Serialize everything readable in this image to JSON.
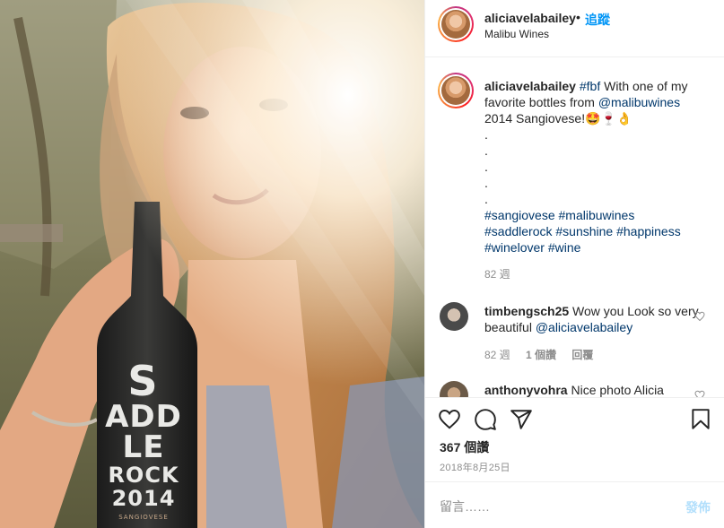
{
  "header": {
    "username": "aliciavelabailey",
    "separator": "•",
    "follow_label": "追蹤",
    "location": "Malibu Wines"
  },
  "photo": {
    "bottle_line1": "S",
    "bottle_line2": "ADD",
    "bottle_line3": "LE",
    "bottle_line4": "ROCK",
    "bottle_year": "2014",
    "bottle_varietal": "SANGIOVESE"
  },
  "caption": {
    "username": "aliciavelabailey",
    "tag_fbf": "#fbf",
    "text1": "With one of my favorite bottles from",
    "mention": "@malibuwines",
    "text2": "2014 Sangiovese!",
    "emojis": "🤩🍷👌",
    "dots": [
      ".",
      ".",
      ".",
      ".",
      "."
    ],
    "hashtags_line1": [
      "#sangiovese",
      "#malibuwines"
    ],
    "hashtags_line2": [
      "#saddlerock",
      "#sunshine",
      "#happiness"
    ],
    "hashtags_line3": [
      "#winelover",
      "#wine"
    ],
    "time": "82 週"
  },
  "comments": [
    {
      "username": "timbengsch25",
      "text": "Wow you Look so very beautiful",
      "mention": "@aliciavelabailey",
      "time": "82 週",
      "likes": "1 個讚",
      "reply": "回覆"
    },
    {
      "username": "anthonyvohra",
      "text": "Nice photo Alicia"
    }
  ],
  "likes": "367 個讚",
  "date": "2018年8月25日",
  "composer": {
    "placeholder": "留言……",
    "post_label": "發佈"
  },
  "colors": {
    "link": "#00376b",
    "follow": "#0095f6",
    "post_disabled": "#b2dffc",
    "muted": "#8e8e8e"
  }
}
